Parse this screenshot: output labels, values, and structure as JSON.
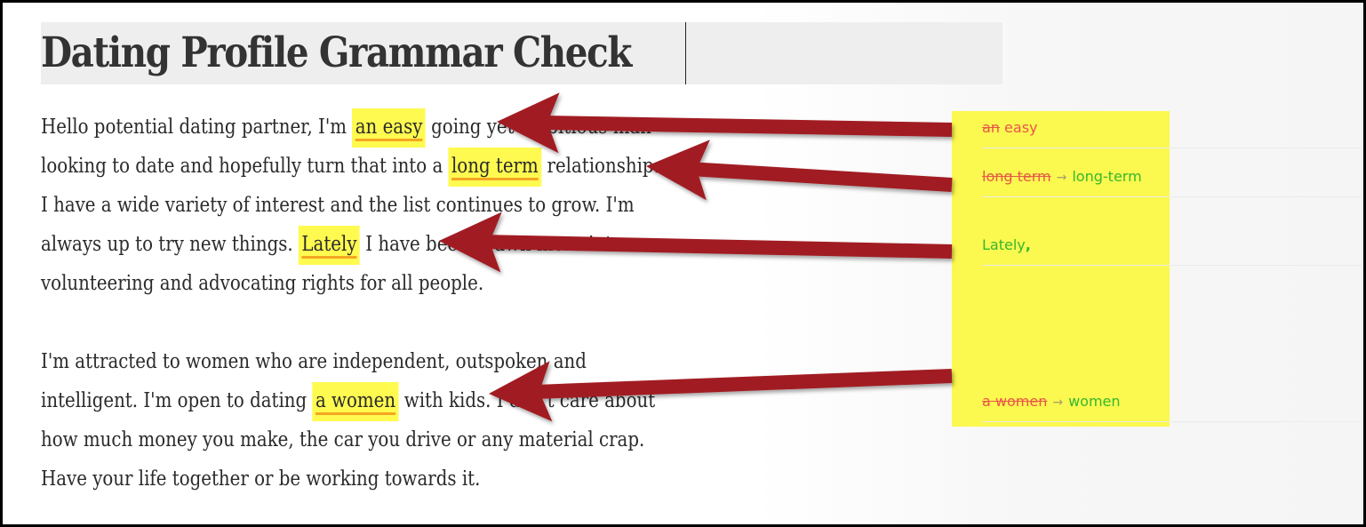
{
  "document": {
    "title": "Dating Profile Grammar Check",
    "paragraphs": [
      {
        "lines": [
          {
            "before": "Hello potential dating partner, I'm ",
            "flag": "an easy",
            "after": " going yet ambitious man"
          },
          {
            "before": "looking to date and hopefully turn that into a ",
            "flag": "long term",
            "after": " relationship."
          },
          {
            "before": "I have a wide variety of interest and the list continues to grow. I'm",
            "flag": "",
            "after": ""
          },
          {
            "before": "always up to try new things. ",
            "flag": "Lately",
            "after": " I have been drawn more into"
          },
          {
            "before": "volunteering and advocating rights for all people.",
            "flag": "",
            "after": ""
          }
        ]
      },
      {
        "lines": [
          {
            "before": "I'm attracted to women who are independent, outspoken and",
            "flag": "",
            "after": ""
          },
          {
            "before": "intelligent. I'm open to dating ",
            "flag": "a women",
            "after": " with kids. I don't care about"
          },
          {
            "before": "how much money you make, the car you drive or any material crap.",
            "flag": "",
            "after": ""
          },
          {
            "before": "Have your life together or be working towards it.",
            "flag": "",
            "after": ""
          }
        ]
      }
    ]
  },
  "suggestions": [
    {
      "removed": "an",
      "kept": "easy",
      "arrow": "",
      "replacement": ""
    },
    {
      "removed": "long term",
      "kept": "",
      "arrow": "→",
      "replacement": "long-term"
    },
    {
      "removed": "",
      "kept": "",
      "arrow": "",
      "replacement": "Lately",
      "added": ","
    },
    {
      "removed": "a women",
      "kept": "",
      "arrow": "→",
      "replacement": "women"
    }
  ],
  "colors": {
    "highlight": "#fffa50",
    "underline": "#f5a623",
    "annotation_arrow": "#a11a22",
    "removed": "#e8574a",
    "inserted": "#36b82e"
  }
}
